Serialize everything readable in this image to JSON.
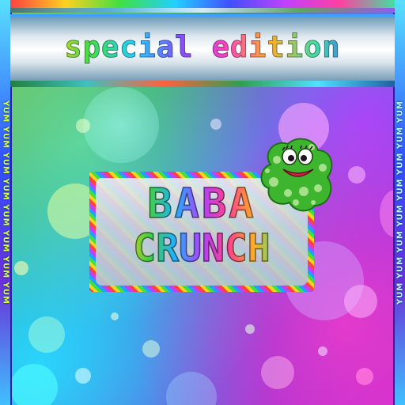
{
  "banner": {
    "subtitle": "special edition"
  },
  "logo": {
    "line1": "BABA",
    "line2": "CRUNCH"
  },
  "sidebars": {
    "left_text": "YUM YUM YUM YUM YUM YUM YUM YUM",
    "right_text": "YUM YUM YUM YUM YUM YUM YUM YUM"
  },
  "icons": {
    "mascot": "green-spotted-monster-icon"
  },
  "colors": {
    "mascot_green": "#3db52f",
    "mascot_spots": "#a6e08a",
    "frame_blue": "#3050ff",
    "background_magenta": "#c02ad0"
  }
}
